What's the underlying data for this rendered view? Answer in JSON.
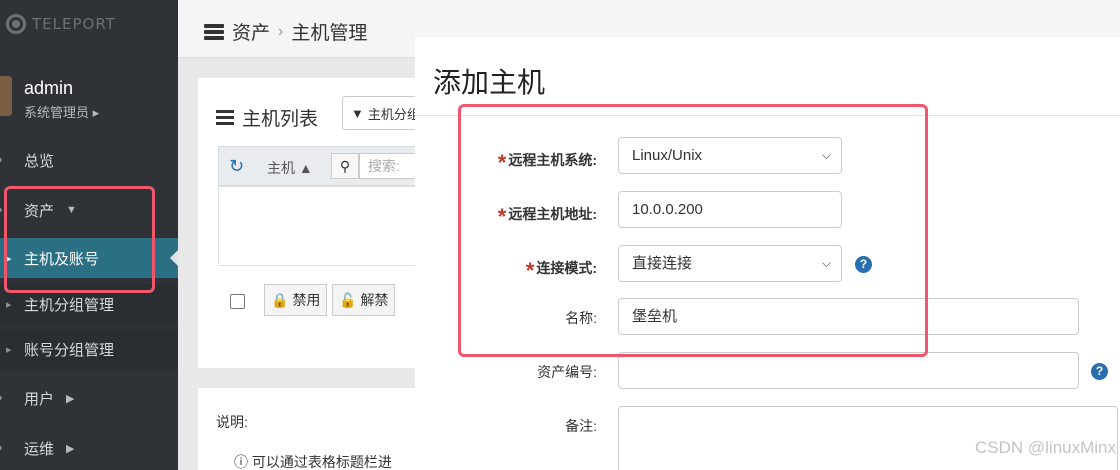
{
  "brand": {
    "logo_text": "TELEPORT"
  },
  "user": {
    "name": "admin",
    "role": "系统管理员 ▸"
  },
  "sidebar": {
    "items": [
      {
        "label": "总览"
      },
      {
        "label": "资产"
      },
      {
        "label": "主机及账号"
      },
      {
        "label": "主机分组管理"
      },
      {
        "label": "账号分组管理"
      },
      {
        "label": "用户"
      },
      {
        "label": "运维"
      }
    ]
  },
  "header": {
    "breadcrumb": [
      "资产",
      "主机管理"
    ],
    "separator": "›"
  },
  "host_list": {
    "title": "主机列表",
    "filter_button": "主机分组",
    "columns": [
      "主机"
    ],
    "search_placeholder": "搜索:",
    "actions": [
      "禁用",
      "解禁"
    ]
  },
  "notes": {
    "title": "说明:",
    "line1": "可以通过表格标题栏进"
  },
  "modal": {
    "title": "添加主机",
    "fields": [
      {
        "label": "远程主机系统:",
        "value": "Linux/Unix"
      },
      {
        "label": "远程主机地址:",
        "value": "10.0.0.200"
      },
      {
        "label": "连接模式:",
        "value": "直接连接"
      },
      {
        "label": "名称:",
        "value": "堡垒机"
      },
      {
        "label": "资产编号:",
        "value": ""
      },
      {
        "label": "备注:",
        "value": ""
      }
    ],
    "help": "?",
    "required_mark": "*"
  },
  "watermark": "CSDN @linuxMinx",
  "colors": {
    "sidebar_bg": "#2f3236",
    "active": "#2a6f83",
    "highlight": "#f0576d",
    "link": "#2a6fad"
  }
}
